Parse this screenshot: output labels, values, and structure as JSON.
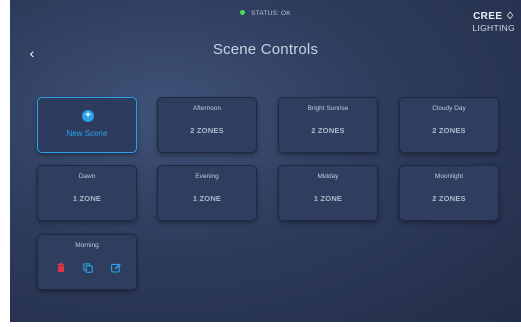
{
  "status": {
    "text": "STATUS: OK",
    "color": "#4cd964"
  },
  "brand": {
    "name": "CREE ♢",
    "sub": "LIGHTING"
  },
  "nav": {
    "back_icon": "chevron-left-icon",
    "back_glyph": "‹"
  },
  "header": {
    "title": "Scene Controls"
  },
  "new_scene": {
    "label": "New Scene",
    "plus": "+",
    "accent": "#2aa3e6"
  },
  "scenes": [
    {
      "name": "Afternoon",
      "zones": "2 ZONES"
    },
    {
      "name": "Bright Sunrise",
      "zones": "2 ZONES"
    },
    {
      "name": "Cloudy Day",
      "zones": "2 ZONES"
    },
    {
      "name": "Dawn",
      "zones": "1 ZONE"
    },
    {
      "name": "Evening",
      "zones": "1 ZONE"
    },
    {
      "name": "Midday",
      "zones": "1 ZONE"
    },
    {
      "name": "Moonlight",
      "zones": "2 ZONES"
    },
    {
      "name": "Morning"
    }
  ],
  "action_colors": {
    "delete": "#e0344a",
    "copy": "#2aa3e6",
    "edit": "#2aa3e6"
  }
}
